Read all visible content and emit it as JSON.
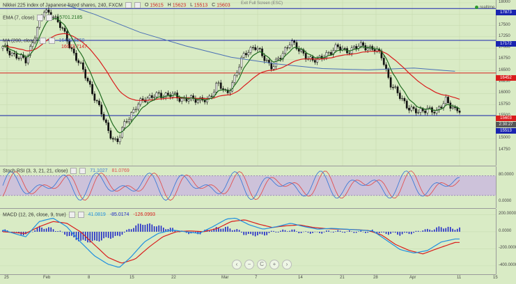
{
  "header": {
    "title": "Nikkei 225 index of Japanese listed shares, 240, FXCM",
    "o_label": "O",
    "o": "15615",
    "h_label": "H",
    "h": "15623",
    "l_label": "L",
    "l": "15513",
    "c_label": "C",
    "c": "15603",
    "exit_fullscreen": "Exit Full Screen (ESC)",
    "realtime": "realtime"
  },
  "indicators": {
    "ema": {
      "label": "EMA (7, close)",
      "value": "15701.2185"
    },
    "ma": {
      "label": "MA (200, close)",
      "value": "16450.6850"
    },
    "ma2_value": "16073.7147",
    "stoch": {
      "label": "Stoch RSI (3, 3, 21, 21, close)",
      "k": "71.1027",
      "d": "81.0769"
    },
    "macd": {
      "label": "MACD (12, 26, close, 9, true)",
      "macd": "41.0819",
      "signal": "-85.0174",
      "hist": "-126.0993"
    }
  },
  "price_tags": {
    "line1": "17873",
    "line2": "17172",
    "line3": "16452",
    "current": "15603",
    "countdown": "2:30:27",
    "line4": "15513"
  },
  "colors": {
    "background": "#d9ebc5",
    "ema": "#1f6b1f",
    "ma": "#d91c1c",
    "ma200": "#4a6fb5",
    "hline_blue": "#1a24b0",
    "hline_red": "#d91c1c",
    "stoch_k": "#3d7ad6",
    "stoch_d": "#e05050",
    "stoch_band": "#c8b4e0",
    "macd_line": "#1f8fe0",
    "signal_line": "#d91c1c",
    "hist": "#1f28c8",
    "tag_current": "#d91c1c"
  },
  "nav_buttons": [
    "‹",
    "−",
    "C",
    "+",
    "›"
  ],
  "chart_data": [
    {
      "type": "candlestick",
      "title": "Nikkei 225 index of Japanese listed shares, 240, FXCM",
      "ylim": [
        14500,
        18000
      ],
      "yticks": [
        "18000",
        "17750",
        "17500",
        "17250",
        "17000",
        "16750",
        "16500",
        "16250",
        "16000",
        "15750",
        "15500",
        "15250",
        "15000",
        "14750"
      ],
      "xticks": [
        "25",
        "Feb",
        "8",
        "15",
        "22",
        "Mar",
        "7",
        "14",
        "21",
        "28",
        "Apr",
        "11",
        "15"
      ],
      "horizontal_lines": [
        {
          "value": 17873,
          "color": "blue"
        },
        {
          "value": 17172,
          "color": "blue"
        },
        {
          "value": 16452,
          "color": "red"
        },
        {
          "value": 15513,
          "color": "blue"
        }
      ],
      "price_path_anchors": [
        [
          0,
          17000
        ],
        [
          0.02,
          16900
        ],
        [
          0.05,
          16700
        ],
        [
          0.07,
          17300
        ],
        [
          0.09,
          17800
        ],
        [
          0.11,
          17750
        ],
        [
          0.13,
          17400
        ],
        [
          0.15,
          17000
        ],
        [
          0.17,
          16600
        ],
        [
          0.19,
          16200
        ],
        [
          0.21,
          15700
        ],
        [
          0.23,
          15200
        ],
        [
          0.25,
          14900
        ],
        [
          0.27,
          15400
        ],
        [
          0.29,
          15700
        ],
        [
          0.31,
          15850
        ],
        [
          0.33,
          16000
        ],
        [
          0.35,
          15900
        ],
        [
          0.37,
          16050
        ],
        [
          0.39,
          15800
        ],
        [
          0.41,
          15950
        ],
        [
          0.43,
          15800
        ],
        [
          0.45,
          15900
        ],
        [
          0.47,
          16200
        ],
        [
          0.49,
          16000
        ],
        [
          0.51,
          16400
        ],
        [
          0.53,
          16900
        ],
        [
          0.55,
          17050
        ],
        [
          0.57,
          16800
        ],
        [
          0.59,
          16600
        ],
        [
          0.61,
          16800
        ],
        [
          0.63,
          17200
        ],
        [
          0.65,
          16900
        ],
        [
          0.67,
          16800
        ],
        [
          0.69,
          16700
        ],
        [
          0.71,
          16900
        ],
        [
          0.73,
          17000
        ],
        [
          0.75,
          16950
        ],
        [
          0.77,
          17000
        ],
        [
          0.79,
          17050
        ],
        [
          0.81,
          17000
        ],
        [
          0.83,
          16800
        ],
        [
          0.85,
          16200
        ],
        [
          0.87,
          15900
        ],
        [
          0.89,
          15700
        ],
        [
          0.91,
          15550
        ],
        [
          0.93,
          15700
        ],
        [
          0.95,
          15550
        ],
        [
          0.97,
          15900
        ],
        [
          0.99,
          15603
        ]
      ],
      "ma200_anchors": [
        [
          0.14,
          17950
        ],
        [
          0.2,
          17750
        ],
        [
          0.3,
          17350
        ],
        [
          0.4,
          17050
        ],
        [
          0.5,
          16800
        ],
        [
          0.6,
          16650
        ],
        [
          0.7,
          16550
        ],
        [
          0.8,
          16520
        ],
        [
          0.9,
          16560
        ],
        [
          0.99,
          16490
        ]
      ]
    },
    {
      "type": "line",
      "title": "Stoch RSI (3, 3, 21, 21, close)",
      "ylim": [
        -10,
        100
      ],
      "yticks": [
        "80.0000",
        "0.0000"
      ],
      "band": [
        20,
        80
      ],
      "series": [
        {
          "name": "K",
          "value": 71.1027
        },
        {
          "name": "D",
          "value": 81.0769
        }
      ]
    },
    {
      "type": "line+bar",
      "title": "MACD (12, 26, close, 9, true)",
      "ylim": [
        -450,
        220
      ],
      "yticks": [
        "200.0000",
        "0.0000",
        "-200.0000",
        "-400.0000"
      ],
      "macd_anchors": [
        [
          0,
          20
        ],
        [
          0.05,
          -60
        ],
        [
          0.08,
          120
        ],
        [
          0.11,
          160
        ],
        [
          0.14,
          60
        ],
        [
          0.17,
          -120
        ],
        [
          0.2,
          -280
        ],
        [
          0.23,
          -380
        ],
        [
          0.255,
          -420
        ],
        [
          0.28,
          -300
        ],
        [
          0.31,
          -120
        ],
        [
          0.34,
          -20
        ],
        [
          0.37,
          20
        ],
        [
          0.4,
          0
        ],
        [
          0.43,
          -20
        ],
        [
          0.46,
          60
        ],
        [
          0.49,
          150
        ],
        [
          0.51,
          160
        ],
        [
          0.54,
          80
        ],
        [
          0.57,
          30
        ],
        [
          0.6,
          60
        ],
        [
          0.63,
          100
        ],
        [
          0.66,
          60
        ],
        [
          0.69,
          30
        ],
        [
          0.72,
          40
        ],
        [
          0.75,
          30
        ],
        [
          0.78,
          20
        ],
        [
          0.81,
          10
        ],
        [
          0.84,
          -100
        ],
        [
          0.87,
          -210
        ],
        [
          0.9,
          -250
        ],
        [
          0.93,
          -220
        ],
        [
          0.96,
          -120
        ],
        [
          0.99,
          -85
        ]
      ],
      "signal_anchors": [
        [
          0,
          0
        ],
        [
          0.05,
          -20
        ],
        [
          0.08,
          60
        ],
        [
          0.11,
          120
        ],
        [
          0.14,
          100
        ],
        [
          0.17,
          0
        ],
        [
          0.2,
          -150
        ],
        [
          0.23,
          -300
        ],
        [
          0.26,
          -370
        ],
        [
          0.29,
          -320
        ],
        [
          0.32,
          -180
        ],
        [
          0.35,
          -60
        ],
        [
          0.38,
          0
        ],
        [
          0.41,
          10
        ],
        [
          0.44,
          0
        ],
        [
          0.47,
          40
        ],
        [
          0.5,
          120
        ],
        [
          0.53,
          140
        ],
        [
          0.56,
          90
        ],
        [
          0.59,
          50
        ],
        [
          0.62,
          70
        ],
        [
          0.65,
          80
        ],
        [
          0.68,
          50
        ],
        [
          0.71,
          35
        ],
        [
          0.74,
          30
        ],
        [
          0.77,
          25
        ],
        [
          0.8,
          15
        ],
        [
          0.83,
          -40
        ],
        [
          0.86,
          -150
        ],
        [
          0.89,
          -220
        ],
        [
          0.92,
          -260
        ],
        [
          0.95,
          -200
        ],
        [
          0.99,
          -126
        ]
      ]
    }
  ]
}
